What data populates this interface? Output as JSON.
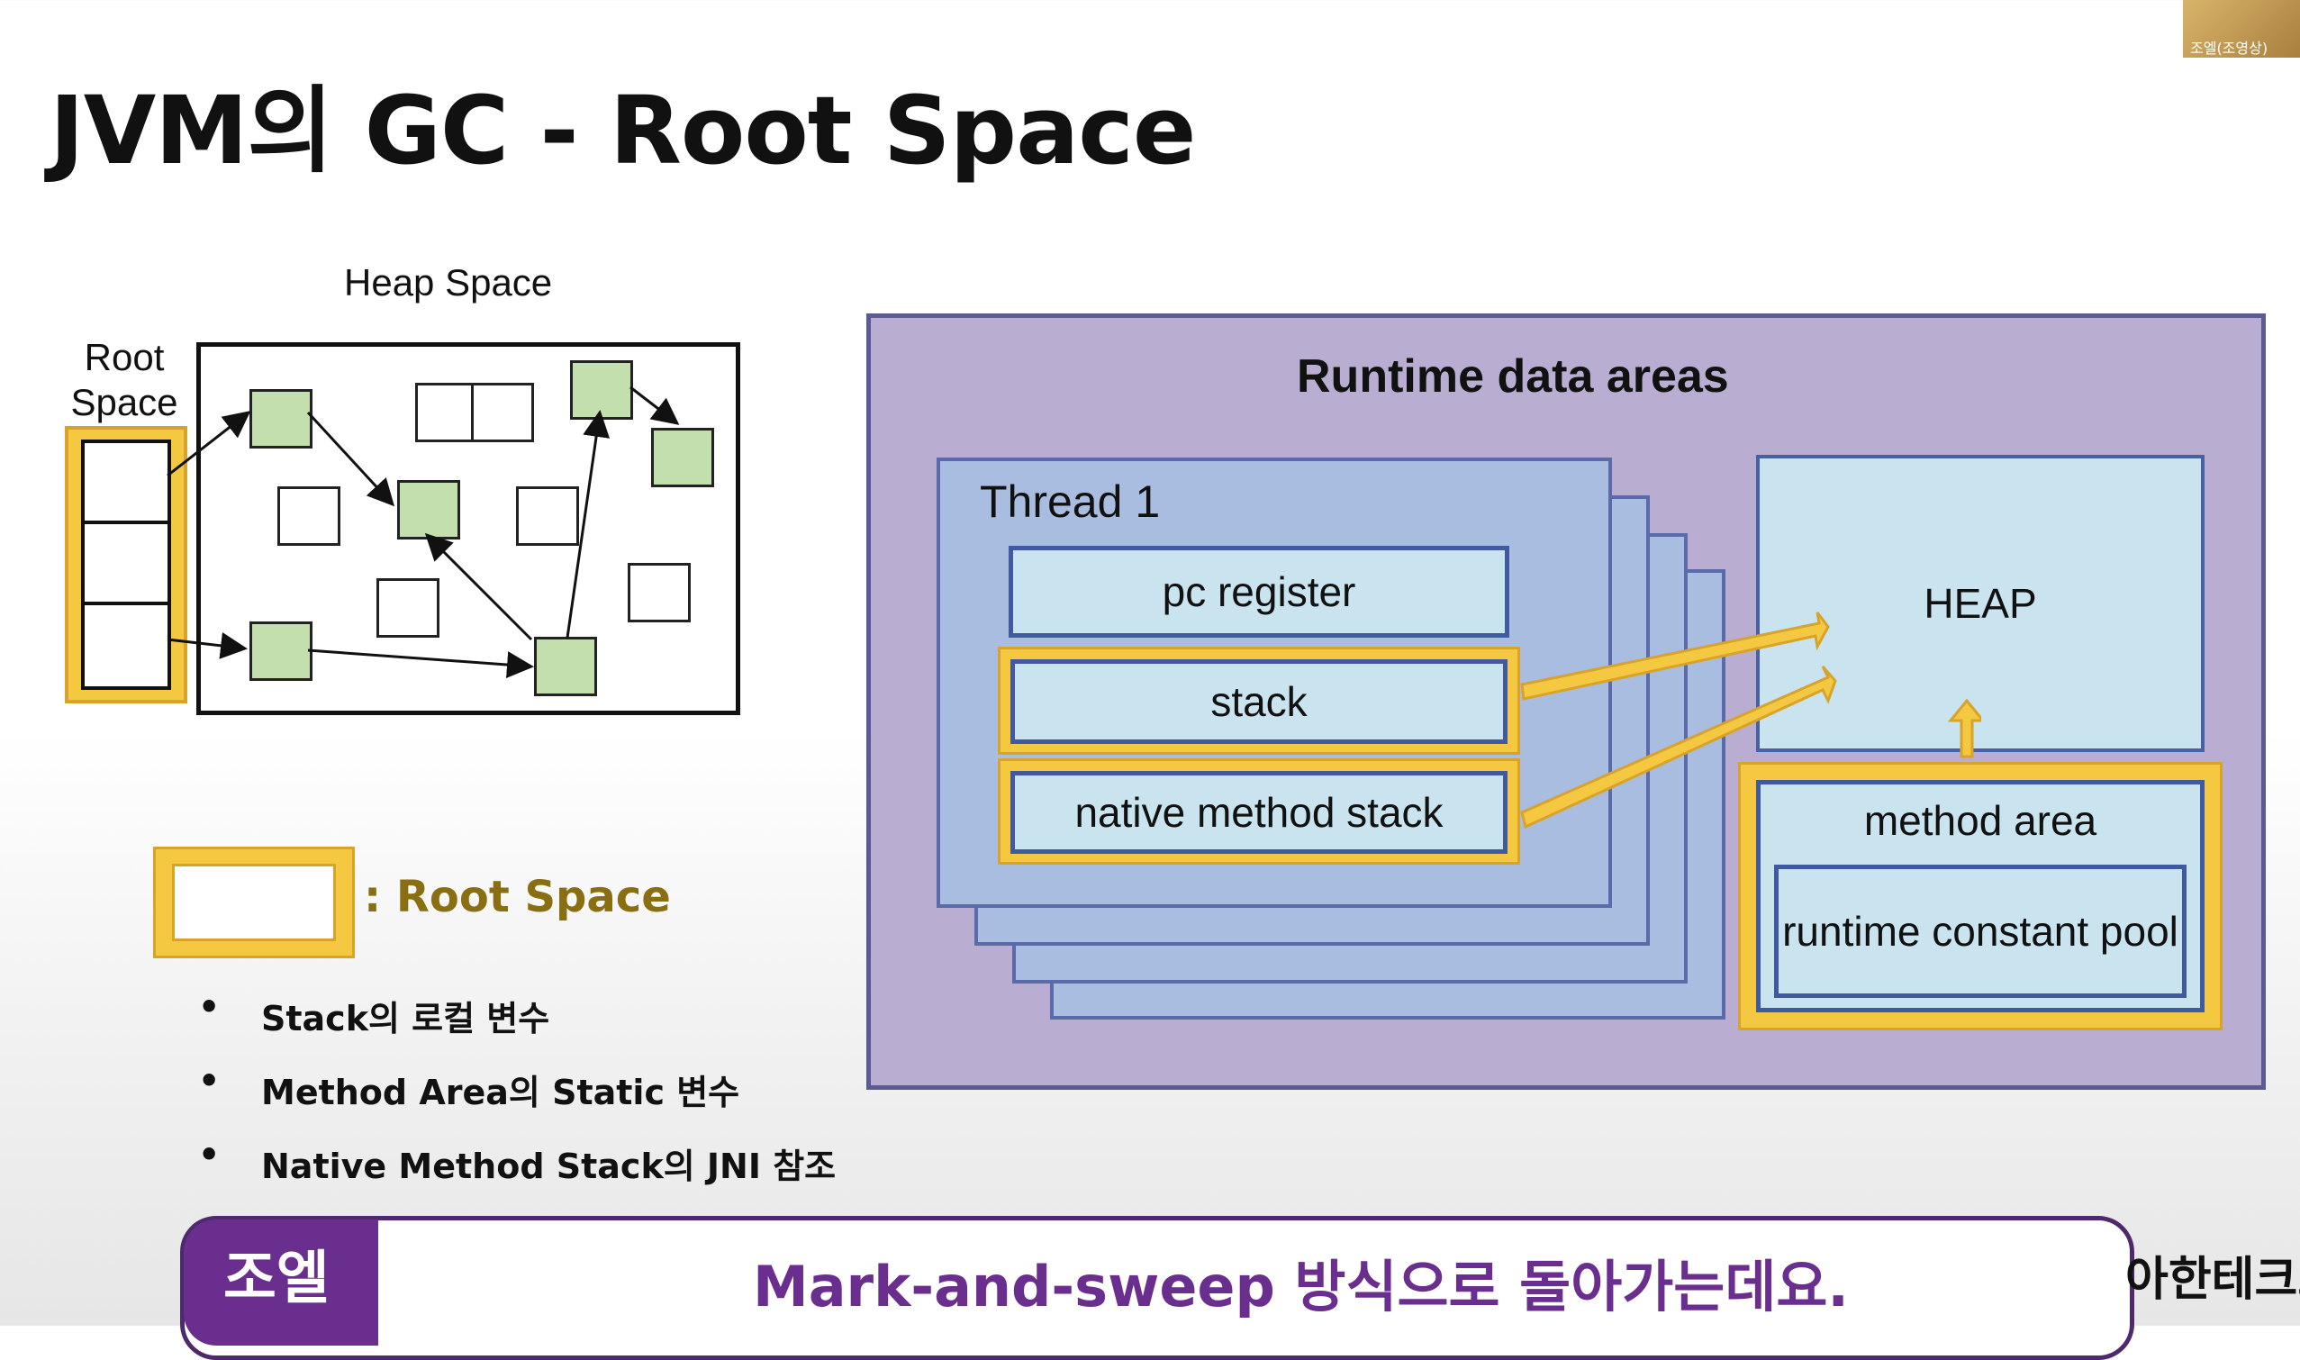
{
  "title": "JVM의 GC - Root Space",
  "webcam_label": "조엘(조영상)",
  "heap_diagram": {
    "heap_label": "Heap Space",
    "root_label": "Root Space"
  },
  "legend": {
    "label": ": Root Space"
  },
  "bullets": [
    "Stack의 로컬 변수",
    "Method Area의 Static 변수",
    "Native Method Stack의 JNI 참조"
  ],
  "runtime": {
    "title": "Runtime data areas",
    "thread_title": "Thread 1",
    "pc_register": "pc register",
    "stack": "stack",
    "native_method_stack": "native method stack",
    "heap": "HEAP",
    "method_area": "method area",
    "runtime_constant_pool": "runtime constant pool"
  },
  "subtitle": {
    "speaker": "조엘",
    "text": "Mark-and-sweep 방식으로 돌아가는데요.",
    "right_text": "아한테크코"
  },
  "colors": {
    "root_gold": "#f5c842",
    "reachable_green": "#c3dfae",
    "runtime_purple": "#b9aed1",
    "thread_blue": "#a9bde0",
    "cell_blue": "#c9e3ef",
    "speaker_purple": "#6a2f8e"
  }
}
